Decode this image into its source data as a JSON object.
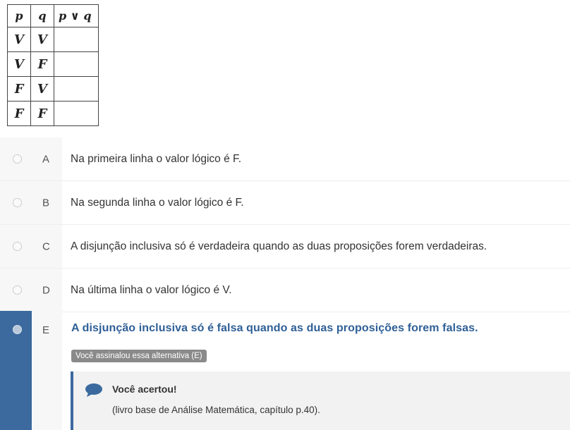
{
  "truth_table": {
    "headers": [
      "p",
      "q",
      "p ∨ q"
    ],
    "rows": [
      [
        "V",
        "V",
        ""
      ],
      [
        "V",
        "F",
        ""
      ],
      [
        "F",
        "V",
        ""
      ],
      [
        "F",
        "F",
        ""
      ]
    ]
  },
  "options": [
    {
      "letter": "A",
      "text": "Na primeira linha o valor lógico é F."
    },
    {
      "letter": "B",
      "text": "Na segunda linha o valor lógico é F."
    },
    {
      "letter": "C",
      "text": "A disjunção inclusiva só é verdadeira quando as duas proposições forem verdadeiras."
    },
    {
      "letter": "D",
      "text": "Na última linha o valor lógico é V."
    }
  ],
  "selected_option": {
    "letter": "E",
    "text": "A disjunção inclusiva só é falsa quando as duas proposições forem falsas.",
    "badge": "Você assinalou essa alternativa (E)"
  },
  "feedback": {
    "icon": "speech-bubble-icon",
    "title": "Você acertou!",
    "body": "(livro base de Análise Matemática, capítulo p.40)."
  },
  "colors": {
    "accent": "#3c6a9e",
    "selected_text": "#2f5f96",
    "badge_bg": "#8a8a8a",
    "feedback_bg": "#f2f2f2"
  }
}
